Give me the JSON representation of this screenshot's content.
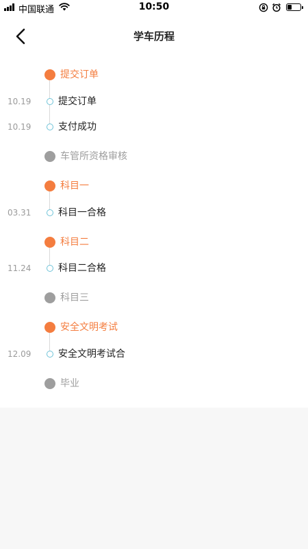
{
  "status_bar": {
    "carrier": "中国联通",
    "time": "10:50",
    "battery_level": 0.35,
    "icons": [
      "signal-icon",
      "wifi-icon",
      "orientation-lock-icon",
      "alarm-icon",
      "battery-icon"
    ]
  },
  "nav": {
    "title": "学车历程",
    "back_icon": "chevron-left-icon"
  },
  "colors": {
    "active": "#f47d3f",
    "inactive": "#9e9e9e",
    "event_ring": "#6ec3d8",
    "line": "#d9d9d9"
  },
  "timeline": {
    "stages": [
      {
        "label": "提交订单",
        "status": "done",
        "events": [
          {
            "date": "10.19",
            "label": "提交订单"
          },
          {
            "date": "10.19",
            "label": "支付成功"
          }
        ]
      },
      {
        "label": "车管所资格审核",
        "status": "pending",
        "events": []
      },
      {
        "label": "科目一",
        "status": "done",
        "events": [
          {
            "date": "03.31",
            "label": "科目一合格"
          }
        ]
      },
      {
        "label": "科目二",
        "status": "done",
        "events": [
          {
            "date": "11.24",
            "label": "科目二合格"
          }
        ]
      },
      {
        "label": "科目三",
        "status": "pending",
        "events": []
      },
      {
        "label": "安全文明考试",
        "status": "done",
        "events": [
          {
            "date": "12.09",
            "label": "安全文明考试合"
          }
        ]
      },
      {
        "label": "毕业",
        "status": "pending",
        "events": []
      }
    ]
  }
}
